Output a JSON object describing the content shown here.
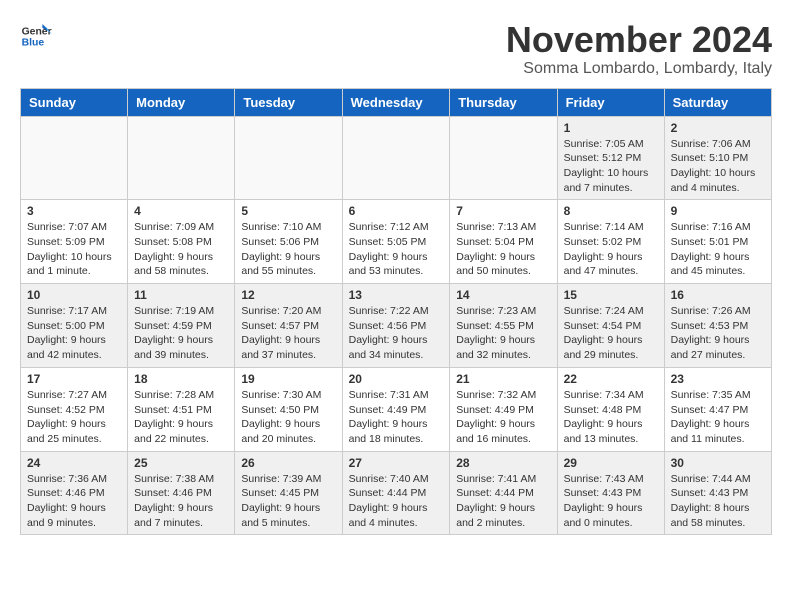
{
  "header": {
    "logo_general": "General",
    "logo_blue": "Blue",
    "month_year": "November 2024",
    "location": "Somma Lombardo, Lombardy, Italy"
  },
  "weekdays": [
    "Sunday",
    "Monday",
    "Tuesday",
    "Wednesday",
    "Thursday",
    "Friday",
    "Saturday"
  ],
  "weeks": [
    [
      {
        "day": "",
        "info": ""
      },
      {
        "day": "",
        "info": ""
      },
      {
        "day": "",
        "info": ""
      },
      {
        "day": "",
        "info": ""
      },
      {
        "day": "",
        "info": ""
      },
      {
        "day": "1",
        "info": "Sunrise: 7:05 AM\nSunset: 5:12 PM\nDaylight: 10 hours\nand 7 minutes."
      },
      {
        "day": "2",
        "info": "Sunrise: 7:06 AM\nSunset: 5:10 PM\nDaylight: 10 hours\nand 4 minutes."
      }
    ],
    [
      {
        "day": "3",
        "info": "Sunrise: 7:07 AM\nSunset: 5:09 PM\nDaylight: 10 hours\nand 1 minute."
      },
      {
        "day": "4",
        "info": "Sunrise: 7:09 AM\nSunset: 5:08 PM\nDaylight: 9 hours\nand 58 minutes."
      },
      {
        "day": "5",
        "info": "Sunrise: 7:10 AM\nSunset: 5:06 PM\nDaylight: 9 hours\nand 55 minutes."
      },
      {
        "day": "6",
        "info": "Sunrise: 7:12 AM\nSunset: 5:05 PM\nDaylight: 9 hours\nand 53 minutes."
      },
      {
        "day": "7",
        "info": "Sunrise: 7:13 AM\nSunset: 5:04 PM\nDaylight: 9 hours\nand 50 minutes."
      },
      {
        "day": "8",
        "info": "Sunrise: 7:14 AM\nSunset: 5:02 PM\nDaylight: 9 hours\nand 47 minutes."
      },
      {
        "day": "9",
        "info": "Sunrise: 7:16 AM\nSunset: 5:01 PM\nDaylight: 9 hours\nand 45 minutes."
      }
    ],
    [
      {
        "day": "10",
        "info": "Sunrise: 7:17 AM\nSunset: 5:00 PM\nDaylight: 9 hours\nand 42 minutes."
      },
      {
        "day": "11",
        "info": "Sunrise: 7:19 AM\nSunset: 4:59 PM\nDaylight: 9 hours\nand 39 minutes."
      },
      {
        "day": "12",
        "info": "Sunrise: 7:20 AM\nSunset: 4:57 PM\nDaylight: 9 hours\nand 37 minutes."
      },
      {
        "day": "13",
        "info": "Sunrise: 7:22 AM\nSunset: 4:56 PM\nDaylight: 9 hours\nand 34 minutes."
      },
      {
        "day": "14",
        "info": "Sunrise: 7:23 AM\nSunset: 4:55 PM\nDaylight: 9 hours\nand 32 minutes."
      },
      {
        "day": "15",
        "info": "Sunrise: 7:24 AM\nSunset: 4:54 PM\nDaylight: 9 hours\nand 29 minutes."
      },
      {
        "day": "16",
        "info": "Sunrise: 7:26 AM\nSunset: 4:53 PM\nDaylight: 9 hours\nand 27 minutes."
      }
    ],
    [
      {
        "day": "17",
        "info": "Sunrise: 7:27 AM\nSunset: 4:52 PM\nDaylight: 9 hours\nand 25 minutes."
      },
      {
        "day": "18",
        "info": "Sunrise: 7:28 AM\nSunset: 4:51 PM\nDaylight: 9 hours\nand 22 minutes."
      },
      {
        "day": "19",
        "info": "Sunrise: 7:30 AM\nSunset: 4:50 PM\nDaylight: 9 hours\nand 20 minutes."
      },
      {
        "day": "20",
        "info": "Sunrise: 7:31 AM\nSunset: 4:49 PM\nDaylight: 9 hours\nand 18 minutes."
      },
      {
        "day": "21",
        "info": "Sunrise: 7:32 AM\nSunset: 4:49 PM\nDaylight: 9 hours\nand 16 minutes."
      },
      {
        "day": "22",
        "info": "Sunrise: 7:34 AM\nSunset: 4:48 PM\nDaylight: 9 hours\nand 13 minutes."
      },
      {
        "day": "23",
        "info": "Sunrise: 7:35 AM\nSunset: 4:47 PM\nDaylight: 9 hours\nand 11 minutes."
      }
    ],
    [
      {
        "day": "24",
        "info": "Sunrise: 7:36 AM\nSunset: 4:46 PM\nDaylight: 9 hours\nand 9 minutes."
      },
      {
        "day": "25",
        "info": "Sunrise: 7:38 AM\nSunset: 4:46 PM\nDaylight: 9 hours\nand 7 minutes."
      },
      {
        "day": "26",
        "info": "Sunrise: 7:39 AM\nSunset: 4:45 PM\nDaylight: 9 hours\nand 5 minutes."
      },
      {
        "day": "27",
        "info": "Sunrise: 7:40 AM\nSunset: 4:44 PM\nDaylight: 9 hours\nand 4 minutes."
      },
      {
        "day": "28",
        "info": "Sunrise: 7:41 AM\nSunset: 4:44 PM\nDaylight: 9 hours\nand 2 minutes."
      },
      {
        "day": "29",
        "info": "Sunrise: 7:43 AM\nSunset: 4:43 PM\nDaylight: 9 hours\nand 0 minutes."
      },
      {
        "day": "30",
        "info": "Sunrise: 7:44 AM\nSunset: 4:43 PM\nDaylight: 8 hours\nand 58 minutes."
      }
    ]
  ]
}
